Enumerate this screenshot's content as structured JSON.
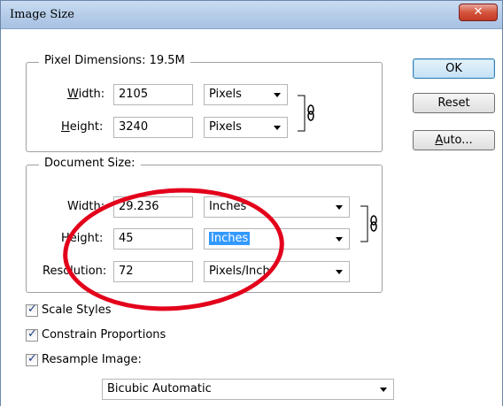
{
  "window": {
    "title": "Image Size",
    "close_label": "✕"
  },
  "pixel_dimensions": {
    "legend": "Pixel Dimensions:  19.5M",
    "width_label": "Width:",
    "width_value": "2105",
    "width_unit": "Pixels",
    "height_label": "Height:",
    "height_value": "3240",
    "height_unit": "Pixels"
  },
  "document_size": {
    "legend": "Document Size:",
    "width_label": "Width:",
    "width_value": "29.236",
    "width_unit": "Inches",
    "height_label": "Height:",
    "height_value": "45",
    "height_unit": "Inches",
    "resolution_label": "Resolution:",
    "resolution_value": "72",
    "resolution_unit": "Pixels/Inch"
  },
  "buttons": {
    "ok": "OK",
    "reset": "Reset",
    "auto": "Auto..."
  },
  "options": {
    "scale_styles": "Scale Styles",
    "constrain_proportions": "Constrain Proportions",
    "resample_image": "Resample Image:",
    "resample_method": "Bicubic Automatic"
  },
  "colors": {
    "highlight_circle": "#e3001b",
    "selection": "#3399ff"
  },
  "icons": {
    "chain_link": "chain-link-icon"
  }
}
